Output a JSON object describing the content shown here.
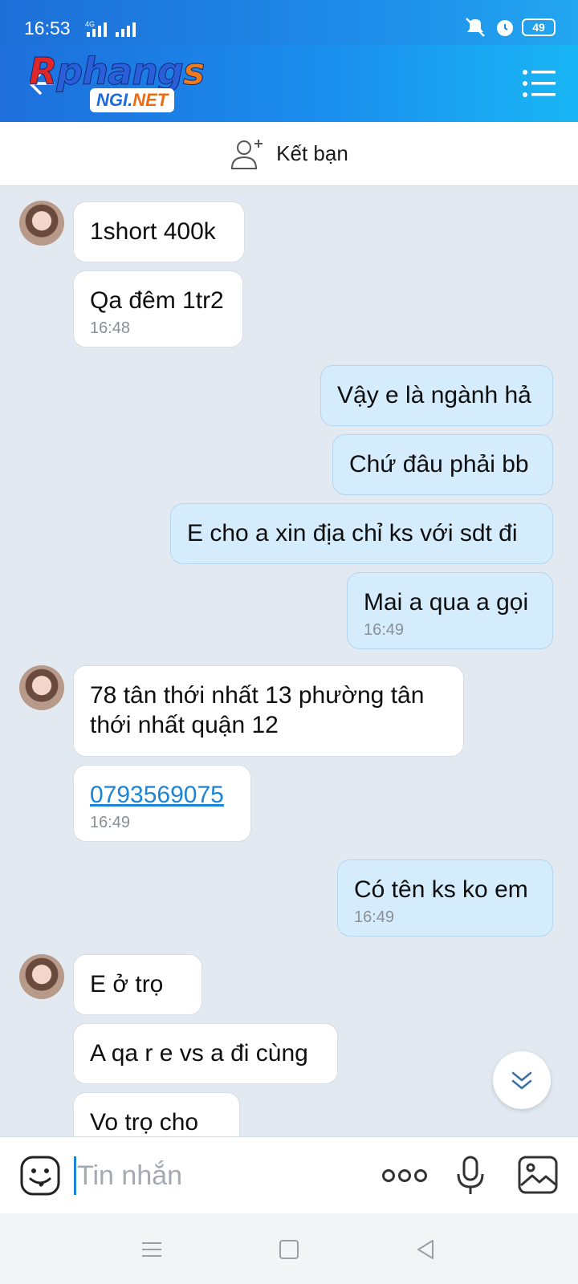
{
  "status_bar": {
    "time": "16:53",
    "network": "4G",
    "battery": "49"
  },
  "header": {
    "logo_main": "Rphang",
    "logo_accent_r": "R",
    "logo_accent_s": "s",
    "logo_badge": "NGI",
    "logo_badge_net": "NET",
    "brand_color": "#1e8ae8"
  },
  "friend_bar": {
    "label": "Kết bạn",
    "icon": "add-person-icon"
  },
  "messages": [
    {
      "side": "in",
      "text": "1short 400k",
      "time": ""
    },
    {
      "side": "in",
      "text": "Qa đêm 1tr2",
      "time": "16:48"
    },
    {
      "side": "out",
      "text": "Vậy e là ngành hả",
      "time": ""
    },
    {
      "side": "out",
      "text": "Chứ đâu phải bb",
      "time": ""
    },
    {
      "side": "out",
      "text": "E cho a xin địa chỉ ks với sdt đi",
      "time": ""
    },
    {
      "side": "out",
      "text": "Mai a qua a gọi",
      "time": "16:49"
    },
    {
      "side": "in",
      "text": "78 tân thới nhất 13 phường tân thới nhất quận 12",
      "time": ""
    },
    {
      "side": "in",
      "text": "0793569075",
      "time": "16:49"
    },
    {
      "side": "out",
      "text": "Có tên ks ko em",
      "time": "16:49"
    },
    {
      "side": "in",
      "text": "E ở trọ",
      "time": ""
    },
    {
      "side": "in",
      "text": "A qa r e vs a đi cùng",
      "time": ""
    },
    {
      "side": "in",
      "text": "Vo trọ cho",
      "time": ""
    }
  ],
  "input": {
    "placeholder": "Tin nhắn",
    "value": ""
  },
  "colors": {
    "incoming_bubble": "#ffffff",
    "outgoing_bubble": "#d5ecfd",
    "chat_background": "#e2e9f1",
    "link": "#1b84d6"
  }
}
